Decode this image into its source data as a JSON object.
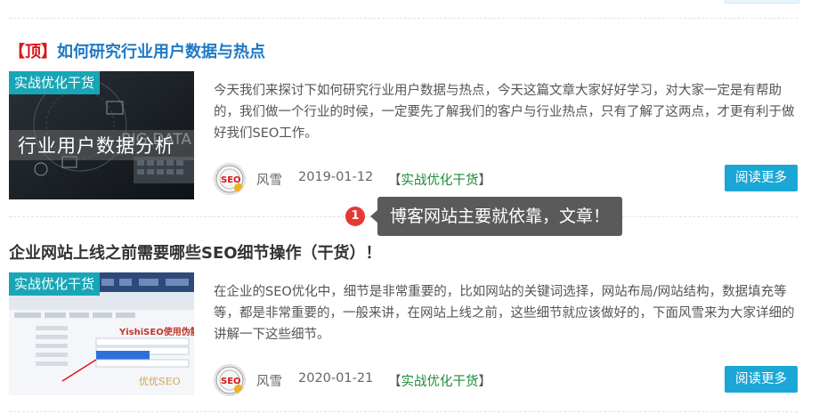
{
  "articles": [
    {
      "pin_label": "【顶】",
      "title": "如何研究行业用户数据与热点",
      "category_tag": "实战优化干货",
      "thumb_text": "行业用户数据分析",
      "thumb_bg_text": "BIG DATA",
      "excerpt": "今天我们来探讨下如何研究行业用户数据与热点，今天这篇文章大家好好学习，对大家一定是有帮助的，我们做一个行业的时候，一定要先了解我们的客户与行业热点，只有了解了这两点，才更有利于做好我们SEO工作。",
      "author": "风雪",
      "date": "2019-01-12",
      "category_open": "【",
      "category": "实战优化干货",
      "category_close": "】",
      "read_more": "阅读更多"
    },
    {
      "pin_label": "",
      "title": "企业网站上线之前需要哪些SEO细节操作（干货）！",
      "category_tag": "实战优化干货",
      "thumb_banner": "YishiSEO使用伪静态",
      "thumb_logo": "优优SEO",
      "excerpt": "在企业的SEO优化中，细节是非常重要的，比如网站的关键词选择，网站布局/网站结构，数据填充等等，都是非常重要的，一般来讲，在网站上线之前，这些细节就应该做好的，下面风雪来为大家详细的讲解一下这些细节。",
      "author": "风雪",
      "date": "2020-01-21",
      "category_open": "【",
      "category": "实战优化干货",
      "category_close": "】",
      "read_more": "阅读更多"
    }
  ],
  "avatar_text": "SEO",
  "tooltip": {
    "badge": "1",
    "text": "博客网站主要就依靠，文章！"
  },
  "colors": {
    "accent_blue": "#1e79c6",
    "button": "#1aa7d6",
    "tag": "#18a6b7",
    "pin_red": "#d9161c",
    "category_green": "#1e8c3a"
  }
}
